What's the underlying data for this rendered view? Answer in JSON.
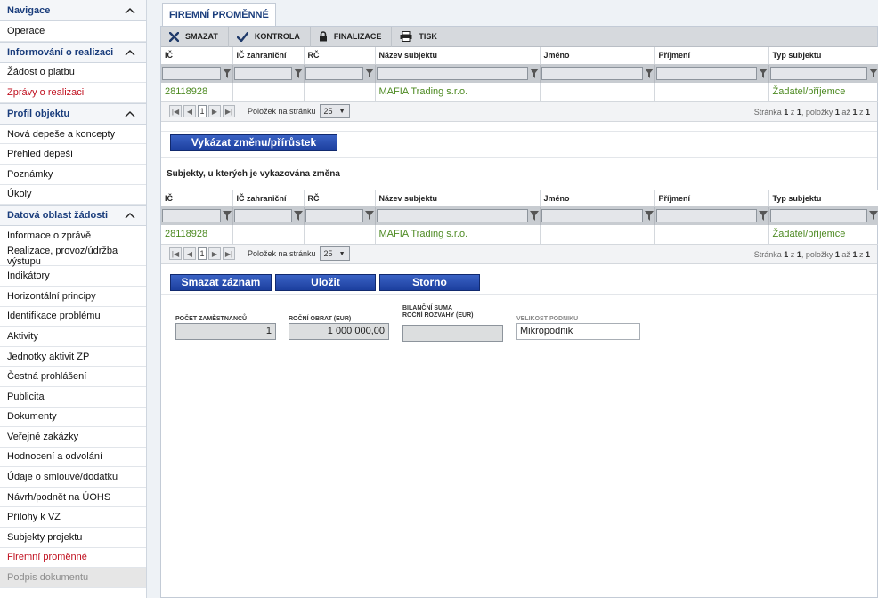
{
  "sidebar": {
    "sections": [
      {
        "title": "Navigace",
        "items": [
          "Operace"
        ]
      },
      {
        "title": "Informování o realizaci",
        "items": [
          "Žádost o platbu",
          "Zprávy o realizaci"
        ]
      },
      {
        "title": "Profil objektu",
        "items": [
          "Nová depeše a koncepty",
          "Přehled depeší",
          "Poznámky",
          "Úkoly"
        ]
      },
      {
        "title": "Datová oblast žádosti",
        "items": [
          "Informace o zprávě",
          "Realizace, provoz/údržba výstupu",
          "Indikátory",
          "Horizontální principy",
          "Identifikace problému",
          "Aktivity",
          "Jednotky aktivit ZP",
          "Čestná prohlášení",
          "Publicita",
          "Dokumenty",
          "Veřejné zakázky",
          "Hodnocení a odvolání",
          "Údaje o smlouvě/dodatku",
          "Návrh/podnět na ÚOHS",
          "Přílohy k VZ",
          "Subjekty projektu",
          "Firemní proměnné",
          "Podpis dokumentu"
        ]
      }
    ],
    "active_item": "Firemní proměnné",
    "highlight_item": "Zprávy o realizaci",
    "disabled_item": "Podpis dokumentu"
  },
  "tab": {
    "label": "FIREMNÍ PROMĚNNÉ"
  },
  "toolbar": {
    "delete": "SMAZAT",
    "check": "KONTROLA",
    "finalize": "FINALIZACE",
    "print": "TISK"
  },
  "grid": {
    "columns": [
      "IČ",
      "IČ zahraniční",
      "RČ",
      "Název subjektu",
      "Jméno",
      "Příjmení",
      "Typ subjektu"
    ],
    "rows": [
      [
        "28118928",
        "",
        "",
        "MAFIA Trading s.r.o.",
        "",
        "",
        "Žadatel/příjemce"
      ]
    ]
  },
  "pager": {
    "page": "1",
    "per_page_label": "Položek na stránku",
    "per_page": "25",
    "info_prefix": "Stránka",
    "info_page": "1",
    "info_of": "z",
    "info_total_pages": "1",
    "info_items": ", položky",
    "info_from": "1",
    "info_to_word": "až",
    "info_to": "1",
    "info_total": "1"
  },
  "report_change_button": "Vykázat změnu/přírůstek",
  "changed_subjects_title": "Subjekty, u kterých je vykazována změna",
  "grid2": {
    "rows": [
      [
        "28118928",
        "",
        "",
        "MAFIA Trading s.r.o.",
        "",
        "",
        "Žadatel/příjemce"
      ]
    ]
  },
  "actions": {
    "delete": "Smazat záznam",
    "save": "Uložit",
    "cancel": "Storno"
  },
  "fields": {
    "employees_label": "POČET ZAMĚSTNANCŮ",
    "employees_value": "1",
    "turnover_label": "ROČNÍ OBRAT (EUR)",
    "turnover_value": "1 000 000,00",
    "balance_label_1": "BILANČNÍ SUMA",
    "balance_label_2": "ROČNÍ ROZVAHY (EUR)",
    "balance_value": "",
    "size_label": "VELIKOST PODNIKU",
    "size_value": "Mikropodnik"
  }
}
